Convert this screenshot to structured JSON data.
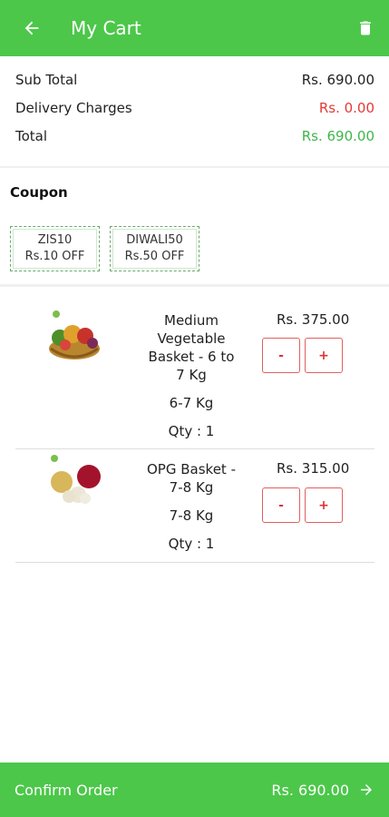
{
  "header": {
    "title": "My Cart",
    "back_icon": "arrow-left-icon",
    "delete_icon": "trash-icon"
  },
  "summary": {
    "subtotal_label": "Sub Total",
    "subtotal_value": "Rs. 690.00",
    "delivery_label": "Delivery Charges",
    "delivery_value": "Rs. 0.00",
    "total_label": "Total",
    "total_value": "Rs. 690.00"
  },
  "coupon": {
    "title": "Coupon",
    "items": [
      {
        "code": "ZIS10",
        "offer": "Rs.10 OFF"
      },
      {
        "code": "DIWALI50",
        "offer": "Rs.50 OFF"
      }
    ]
  },
  "cart": {
    "items": [
      {
        "name": "Medium Vegetable Basket - 6 to 7 Kg",
        "weight": "6-7 Kg",
        "qty": "Qty : 1",
        "price": "Rs. 375.00",
        "minus": "-",
        "plus": "+"
      },
      {
        "name": "OPG Basket - 7-8 Kg",
        "weight": "7-8 Kg",
        "qty": "Qty : 1",
        "price": "Rs. 315.00",
        "minus": "-",
        "plus": "+"
      }
    ]
  },
  "footer": {
    "confirm_label": "Confirm Order",
    "total": "Rs. 690.00",
    "arrow_icon": "arrow-right-icon"
  },
  "colors": {
    "primary": "#4cc74a",
    "red": "#e53935",
    "green_text": "#3fb64a"
  }
}
